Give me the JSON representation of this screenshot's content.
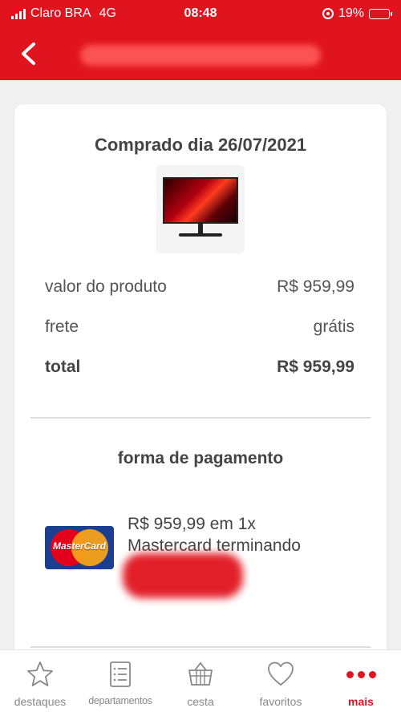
{
  "status_bar": {
    "carrier": "Claro BRA",
    "network": "4G",
    "time": "08:48",
    "battery": "19%"
  },
  "header": {
    "back_icon": "chevron-left-icon"
  },
  "order": {
    "purchase_date": "Comprado dia 26/07/2021",
    "product_image": "monitor",
    "rows": [
      {
        "label": "valor do produto",
        "value": "R$ 959,99"
      },
      {
        "label": "frete",
        "value": "grátis"
      },
      {
        "label": "total",
        "value": "R$ 959,99"
      }
    ]
  },
  "payment": {
    "title": "forma de pagamento",
    "card_brand": "MasterCard",
    "amount_line": "R$ 959,99 em 1x",
    "card_line": "Mastercard terminando"
  },
  "tabs": [
    {
      "label": "destaques",
      "icon": "star-icon"
    },
    {
      "label": "departamentos",
      "icon": "list-icon"
    },
    {
      "label": "cesta",
      "icon": "basket-icon"
    },
    {
      "label": "favoritos",
      "icon": "heart-icon"
    },
    {
      "label": "mais",
      "icon": "more-dots-icon",
      "active": true
    }
  ],
  "colors": {
    "brand_red": "#e0141e"
  }
}
